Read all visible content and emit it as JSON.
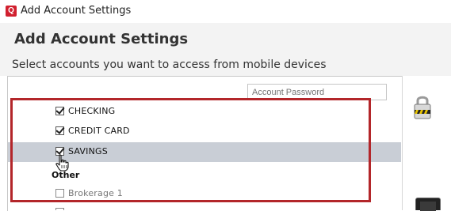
{
  "window": {
    "app_icon_letter": "Q",
    "title": "Add Account Settings"
  },
  "header": {
    "heading": "Add Account Settings",
    "subheading": "Select accounts you want to access from mobile devices"
  },
  "password": {
    "placeholder": "Account Password"
  },
  "accounts": [
    {
      "label": "CHECKING",
      "checked": true
    },
    {
      "label": "CREDIT CARD",
      "checked": true
    },
    {
      "label": "SAVINGS",
      "checked": true,
      "selected": true
    }
  ],
  "other_group": {
    "label": "Other",
    "items": [
      {
        "label": "Brokerage 1",
        "checked": false
      }
    ]
  },
  "colors": {
    "accent": "#b3262a",
    "selected_row": "#c9ced6",
    "brand": "#d1202f"
  },
  "icons": [
    "app-icon",
    "lock-icon",
    "hand-cursor-icon",
    "device-icon"
  ]
}
